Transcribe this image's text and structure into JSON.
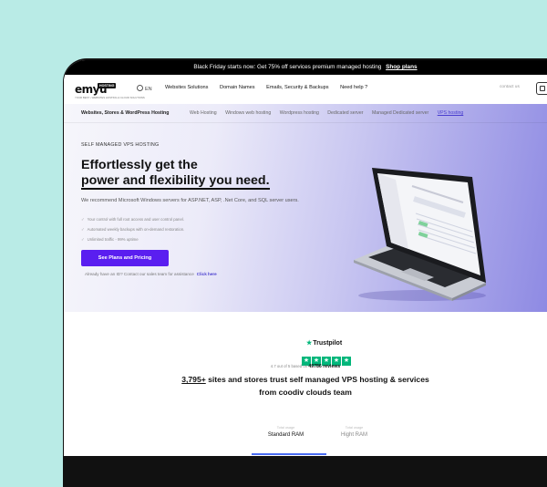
{
  "promo": {
    "text": "Black Friday starts now: Get 75% off services premium managed hosting",
    "link": "Shop plans"
  },
  "nav": {
    "logo": "emyu",
    "logo_badge": "HOSTING",
    "logo_tagline": "YOUR BEST • WEBSITES HOSTING & CLOUD SOLUTIONS",
    "language": "EN",
    "menu": [
      "Websites Solutions",
      "Domain Names",
      "Emails, Security & Backups",
      "Need help ?"
    ],
    "contact": "contact us"
  },
  "subnav": {
    "title": "Websites, Stores & WordPress Hosting",
    "links": [
      "Web Hosting",
      "Windows web hosting",
      "Wordpress hosting",
      "Dedicated server",
      "Managed Dedicated server",
      "VPS hosting"
    ],
    "active_index": 5
  },
  "hero": {
    "eyebrow": "SELF MANAGED VPS HOSTING",
    "headline_line1": "Effortlessly get the",
    "headline_line2": "power and flexibility you need.",
    "description": "We recommend Microsoft Windows servers for ASP.NET, ASP, .Net Core, and SQL server users.",
    "bullets": [
      "Your control with full root access and user control panel.",
      "Automated weekly backups with on-demand restoration.",
      "Unlimited traffic - 99% uptime"
    ],
    "cta_label": "See Plans and Pricing",
    "cta_note": "Already have an ID? Contact our sales team for assistance",
    "cta_link": "Click here"
  },
  "laptop_screen": {
    "title": "CODIV VPS CLIENTS",
    "label": "Dashboard"
  },
  "trustpilot": {
    "brand": "Trustpilot",
    "rating_text": "4.7 out of 5 based on",
    "reviews_count": "49786 reviews",
    "stat_number": "3,795+",
    "stat_text": "sites and stores trust self managed VPS hosting & services",
    "stat_text_2": "from coodiv clouds team"
  },
  "tabs": [
    {
      "caption": "Total usage",
      "label": "Standard RAM"
    },
    {
      "caption": "Total usage",
      "label": "Hight RAM"
    }
  ],
  "colors": {
    "accent": "#5a1ef0",
    "trustpilot_green": "#00b67a",
    "background": "#b9ebe6"
  }
}
